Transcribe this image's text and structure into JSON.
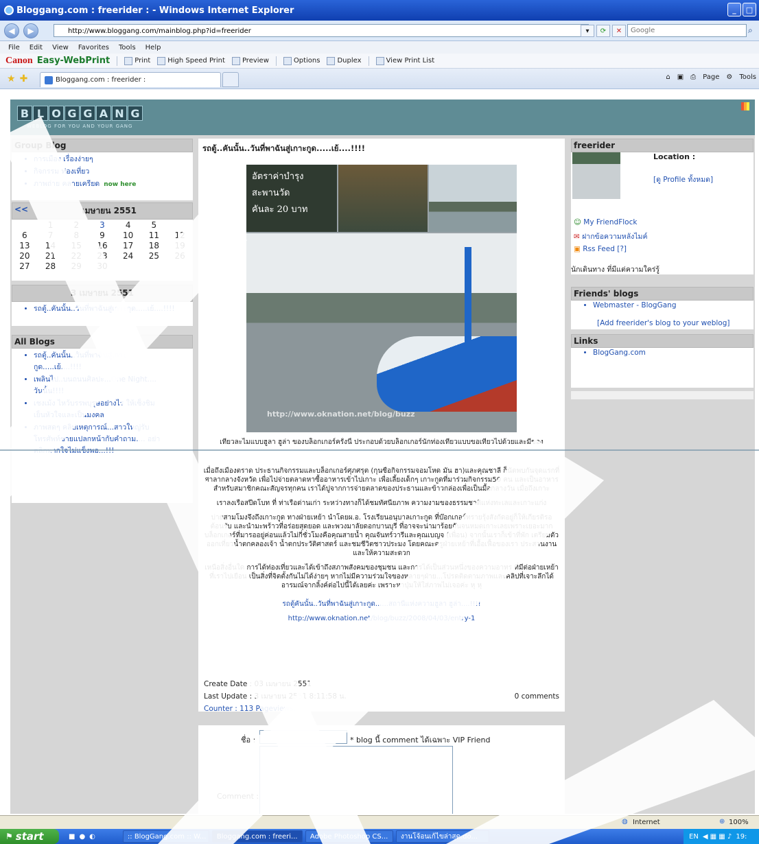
{
  "window": {
    "title": "Bloggang.com : freerider : - Windows Internet Explorer",
    "minimize_glyph": "_",
    "maximize_glyph": "□"
  },
  "address": {
    "url": "http://www.bloggang.com/mainblog.php?id=freerider",
    "search_placeholder": "Google"
  },
  "menu": [
    "File",
    "Edit",
    "View",
    "Favorites",
    "Tools",
    "Help"
  ],
  "canon_toolbar": {
    "brand": "Canon",
    "product": "Easy-WebPrint",
    "print": "Print",
    "high_speed": "High Speed Print",
    "preview": "Preview",
    "options": "Options",
    "duplex": "Duplex",
    "view_list": "View Print List"
  },
  "tabs": {
    "active_title": "Bloggang.com : freerider :",
    "cmd_page": "Page",
    "cmd_tools": "Tools"
  },
  "banner": {
    "letters": [
      "B",
      "L",
      "O",
      "G",
      "G",
      "A",
      "N",
      "G"
    ],
    "tagline": "WEBLOG FOR YOU AND YOUR GANG"
  },
  "group_blog": {
    "heading": "Group Blog",
    "items": [
      "การเมือง เรื่องง่ายๆ",
      "กิจกรรม ท่องเที่ยว",
      "ภาพถ่าย คลายเครียด"
    ],
    "new_label": "now here"
  },
  "calendar": {
    "prev": "<<",
    "month": "เมษายน 2551",
    "rows": [
      [
        "",
        "1",
        "2",
        "3",
        "4",
        "5"
      ],
      [
        "6",
        "7",
        "8",
        "9",
        "10",
        "11",
        "12"
      ],
      [
        "13",
        "14",
        "15",
        "16",
        "17",
        "18",
        "19"
      ],
      [
        "20",
        "21",
        "22",
        "23",
        "24",
        "25",
        "26"
      ],
      [
        "27",
        "28",
        "29",
        "30"
      ]
    ]
  },
  "date_box": {
    "heading": "3 เมษายน 2551",
    "item": "รถตู้..คันนั้น..วันที่พาฉันสู่เกาะกูด.....เย้....!!!!"
  },
  "all_blogs": {
    "heading": "All Blogs",
    "items": [
      "รถตู้..คันนั้น..วันที่พาฉันสู่เกาะกูด.....เย้....!!!!",
      "เพลินไป..บนถนนศิลปะ...One Night.... วันนั้น!!!!",
      "เชงเม้ง ไหว้บรรพบุรุษอย่างไร ให้เซ็งชิม เย็นหัวใจและเป็นมงคล",
      "ภาพสดๆ คลิปเหตุการณ์...สาวใหญ่รับโทรศัพท์ชายแปลกหน้ากับคำถาม.... อย่าคลิกหากใจไม่แข็งพอ...!!!"
    ]
  },
  "post": {
    "title": "รถตู้..คันนั้น..วันที่พาฉันสู่เกาะกูด.....เย้....!!!!",
    "photo_sign_lines": [
      "อัตราค่าบำรุง",
      "สะพานวัด",
      "คันละ 20 บาท"
    ],
    "watermark": "http://www.oknation.net/blog/buzz",
    "intro": "เที่ยวละไมแบบฮูลา ฮูล่า ของบล็อกเกอร์ครั้งนี้ ประกอบด้วยบล็อกเกอร์นักท่องเที่ยวแบบขอเที่ยวไปด้วยและมีของ",
    "p1": "เมื่อถึงเมืองตราด ประธานกิจกรรมและบล็อกเกอร์ศุภศรุต (กุนซือกิจกรรมจอมโหด มัน ฮา)และคุณชาลี ก็นัดพบกันจุดแรกที่ศาลากลางจังหวัด เพื่อไปจ่ายตลาดหาซื้ออาหารเข้าไปเกาะ เพื่อเลี้ยงเด็กๆ เกาะกูดที่มาร่วมกิจกรรม50 คน และเป็นอาหารสำหรับสมาชิกคณะสัญจรทุกคน เราได้ปูจากการจ่ายตลาดของประธานและข้าวกล่องเพื่อเป็นมื้อกลางวัน เมื่อถึงเกาะ",
    "p1b": "เราลงเรือสปีดโบท ที่ ท่าเรือด่านเก่า ระหว่างทางก็ได้ชมทัศนียภาพ ความงามของธรรมชาติแห่งทะเลและเกาะแก่ง",
    "p2": "บ่ายสามโมงจึงถึงเกาะกูด ทางฝ่ายเหย้า นำโดยผ.อ. โรงเรียนอนุบาลเกาะกูด ที่บ๊อกเกอร์ทรายรุ้งสังกัดอยู่ก็ให้เกียรติรอต้อนรับ และนำมะพร้าวที่อร่อยสุดยอด และพวงมาลัยดอกบานบุรี ที่อาจจะน่ามาร้อยกันจนหมดเกาะเลยเพราะเยอะมาก บล็อกเกอร์ที่มารออยู่ค่อนแล้วไม่กี่ชั่วโมงคือคุณสายน้ำ คุณจันทร์วารีและคุณเบญจ (เพื่อน) จากนั้นเราก็เข้าที่พัก เตรียมตัวออกเที่ยวน้ำตกคลองเจ้า น้ำตกประวัติศาสตร์ และชมชีวิตชาวประมง โดยคณะครูฝ่ายเหย้าที่เอื้อเฟื้อของเรา ประสานงานและให้ความสะดวก",
    "p3": "เหนือสิ่งอื่นใด การได้ท่องเที่ยวและได้เข้าถึงสภาพสังคมของชุมชน และการได้เป็นส่วนหนึ่งของความอาทร ที่มีต่อฝ่ายเหย้า ที่เราไปเยือน เป็นสิ่งที่จิตตั้งกันไม่ได้ง่ายๆ หากไม่มีความร่วมใจของหลายๆฝ่าย...โปรดติดตามภาพและคลิปที่เจาะลึกได้อารมณ์จากลิ้งค์ต่อไปนี้ได้เลยค่ะ เพราะหาปุ่มให้ใส่ภาพไม่เจอค่ะ หุ หุ",
    "link_text": "รถตู้คันนั้น..วันที่พาฉันสู่เกาะกูด......สถานีแห่งความฮูลา ฮูล่า....!!!!",
    "link_url": "http://www.oknation.net/blog/buzz/2008/04/03/entry-1",
    "create_date": "Create Date : 03 เมษายน 2551",
    "last_update": "Last Update : 3 เมษายน 2551 8:11:58 น.",
    "comments": "0 comments",
    "counter": "Counter : 113 Pageviews."
  },
  "comment_form": {
    "name_label": "ชื่อ :",
    "vip_note": "* blog นี้ comment ได้เฉพาะ VIP Friend",
    "comment_label": "Comment :"
  },
  "profile": {
    "heading": "freerider",
    "location_label": "Location :",
    "profile_link": "[ดู Profile ทั้งหมด]",
    "friendflock": "My FriendFlock",
    "message": "ฝากข้อความหลังไมค์",
    "rss": "Rss Feed [?]",
    "bio": "นักเดินทาง ที่มีแต่ความใคร่รู้"
  },
  "friends": {
    "heading": "Friends' blogs",
    "items": [
      "Webmaster - BlogGang"
    ],
    "add_link": "[Add freerider's blog to your weblog]"
  },
  "links": {
    "heading": "Links",
    "items": [
      "BlogGang.com"
    ]
  },
  "status": {
    "zone": "Internet",
    "zoom": "100%"
  },
  "taskbar": {
    "start": "start",
    "tasks": [
      ":: BlogGang.com :: W...",
      "Bloggang.com : freeri...",
      "Adobe Photoshop CS...",
      "งานโจ้อนเก้ไขล่าสุด.do..."
    ],
    "lang": "EN",
    "clock": "19:"
  },
  "colors": {
    "banner": "#5f8c95",
    "page_bg": "#d6d6d6",
    "link": "#2050b0",
    "overlay": "#ffffff"
  }
}
